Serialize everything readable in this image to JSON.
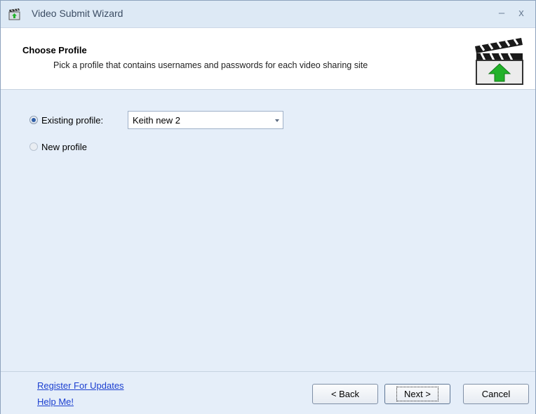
{
  "window": {
    "title": "Video Submit Wizard",
    "minimize_glyph": "–",
    "close_glyph": "x"
  },
  "header": {
    "title": "Choose Profile",
    "subtitle": "Pick a profile that contains usernames and passwords for each video sharing site",
    "icon": "clapperboard-upload-icon"
  },
  "profile": {
    "existing_label": "Existing profile:",
    "existing_selected": true,
    "selected_value": "Keith new 2",
    "new_label": "New profile",
    "new_selected": false
  },
  "footer": {
    "register_link": "Register For Updates",
    "help_link": "Help Me!",
    "back_label": "< Back",
    "next_label": "Next >",
    "cancel_label": "Cancel"
  },
  "colors": {
    "link": "#1b3fd0",
    "panel_background": "#e5eef9",
    "arrow_green": "#22b22a"
  }
}
